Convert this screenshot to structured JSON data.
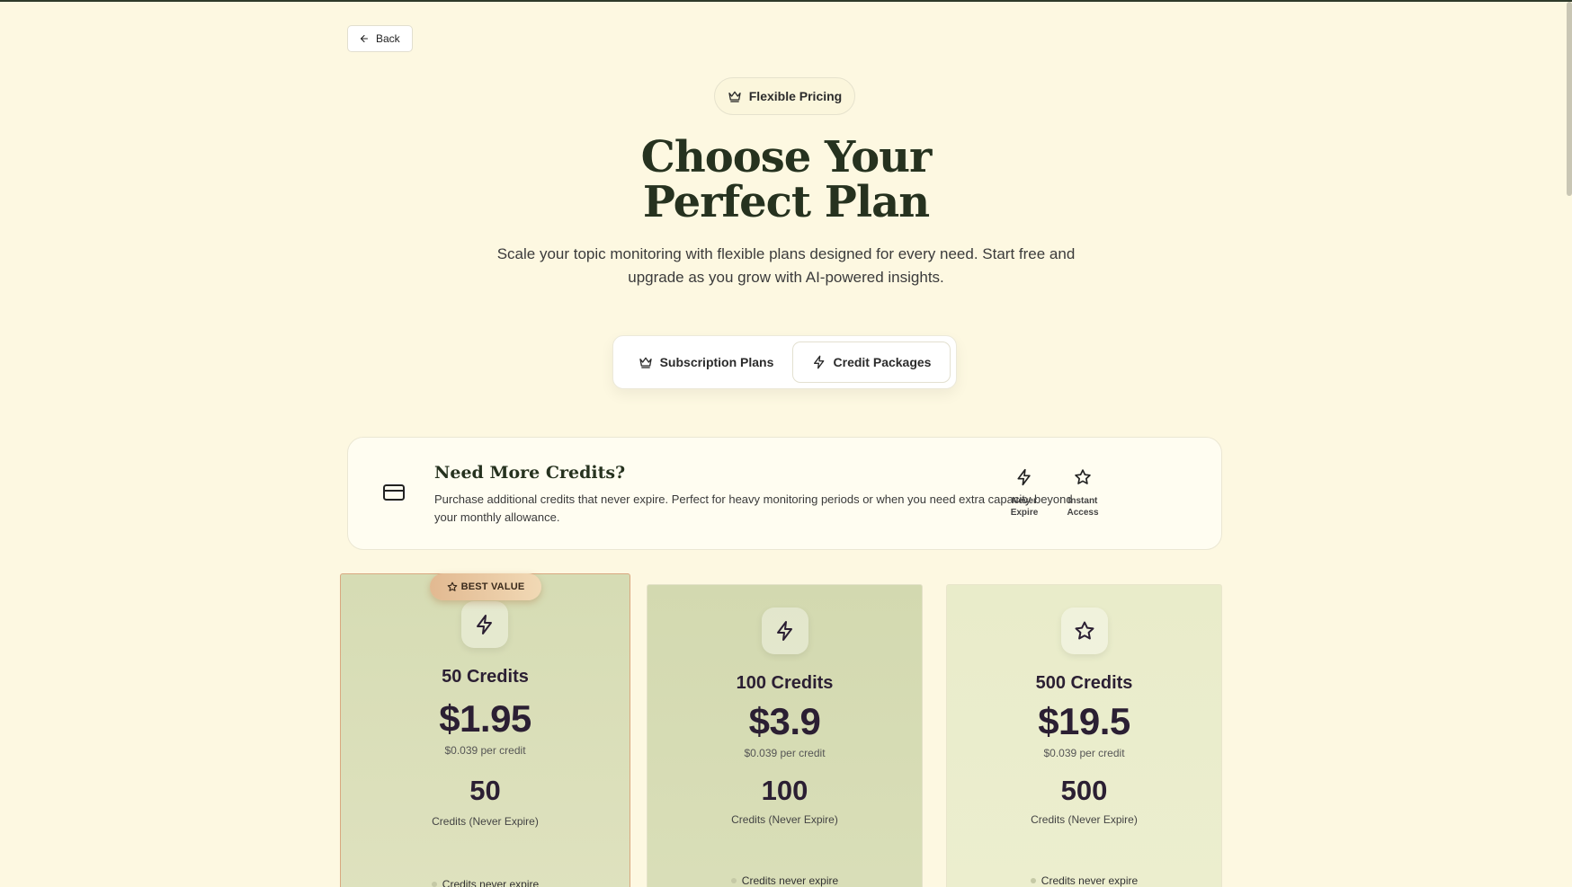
{
  "nav": {
    "back_label": "Back"
  },
  "hero": {
    "pill_label": "Flexible Pricing",
    "title_line1": "Choose Your",
    "title_line2": "Perfect Plan",
    "subtitle_line1": "Scale your topic monitoring with flexible plans designed for every need. Start free and",
    "subtitle_line2": "upgrade as you grow with AI-powered insights."
  },
  "tabs": {
    "subscription_label": "Subscription Plans",
    "credits_label": "Credit Packages",
    "active": "Credit Packages"
  },
  "info": {
    "title": "Need More Credits?",
    "description": "Purchase additional credits that never expire. Perfect for heavy monitoring periods or when you need extra capacity beyond your monthly allowance.",
    "features": [
      {
        "line1": "Never",
        "line2": "Expire",
        "icon": "lightning-icon"
      },
      {
        "line1": "Instant",
        "line2": "Access",
        "icon": "star-icon"
      }
    ]
  },
  "packages": [
    {
      "badge": "BEST VALUE",
      "icon": "lightning-icon",
      "name": "50 Credits",
      "price": "$1.95",
      "per_credit": "$0.039 per credit",
      "count": "50",
      "count_label": "Credits (Never Expire)",
      "feature": "Credits never expire"
    },
    {
      "icon": "lightning-icon",
      "name": "100 Credits",
      "price": "$3.9",
      "per_credit": "$0.039 per credit",
      "count": "100",
      "count_label": "Credits (Never Expire)",
      "feature": "Credits never expire"
    },
    {
      "icon": "star-icon",
      "name": "500 Credits",
      "price": "$19.5",
      "per_credit": "$0.039 per credit",
      "count": "500",
      "count_label": "Credits (Never Expire)",
      "feature": "Credits never expire"
    }
  ],
  "colors": {
    "background": "#fdf8e1",
    "heading": "#26321f",
    "badge_accent": "#e2b991",
    "price_text": "#2b1f33"
  }
}
